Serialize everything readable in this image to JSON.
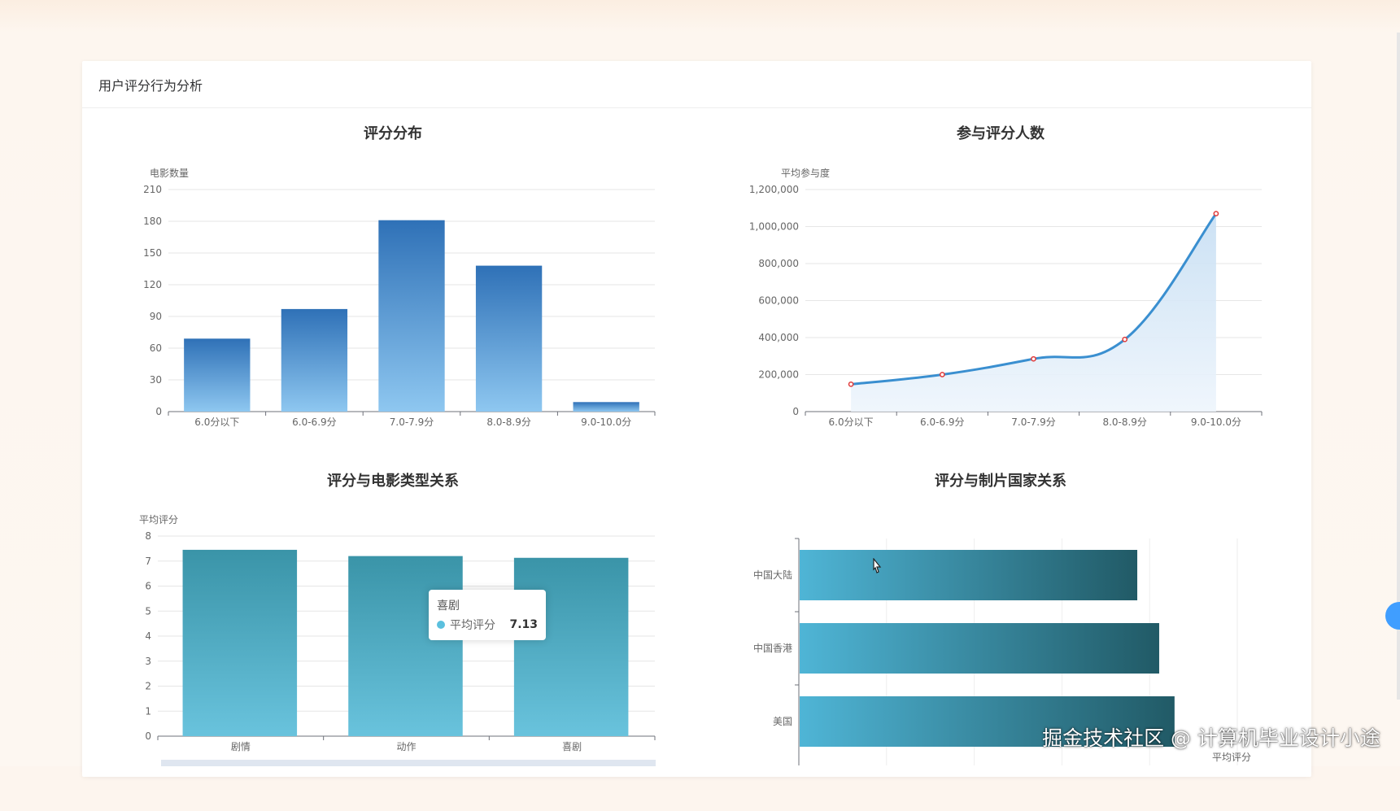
{
  "page": {
    "card_title": "用户评分行为分析",
    "watermark": "掘金技术社区 @ 计算机毕业设计小途"
  },
  "charts": {
    "rating_distribution": {
      "title": "评分分布",
      "ylabel": "电影数量"
    },
    "participation": {
      "title": "参与评分人数",
      "ylabel": "平均参与度"
    },
    "genre_relation": {
      "title": "评分与电影类型关系",
      "ylabel": "平均评分"
    },
    "country_relation": {
      "title": "评分与制片国家关系",
      "xlabel": "平均评分"
    }
  },
  "tooltip": {
    "title": "喜剧",
    "series": "平均评分",
    "value": "7.13",
    "color": "#5bc0de"
  },
  "colors": {
    "bar_top": "#2f71b7",
    "bar_bottom": "#8ec7f0",
    "line": "#3a8fd0",
    "area": "#cfe4f6",
    "point": "#e03a3a",
    "genre_top": "#3a94a8",
    "genre_bottom": "#69c3dd",
    "country_start": "#4fb5d6",
    "country_end": "#215a66"
  },
  "chart_data": [
    {
      "type": "bar",
      "title": "评分分布",
      "ylabel": "电影数量",
      "categories": [
        "6.0分以下",
        "6.0-6.9分",
        "7.0-7.9分",
        "8.0-8.9分",
        "9.0-10.0分"
      ],
      "values": [
        69,
        97,
        181,
        138,
        9
      ],
      "ylim": [
        0,
        210
      ],
      "yticks": [
        0,
        30,
        60,
        90,
        120,
        150,
        180,
        210
      ],
      "grid": true
    },
    {
      "type": "area",
      "title": "参与评分人数",
      "ylabel": "平均参与度",
      "categories": [
        "6.0分以下",
        "6.0-6.9分",
        "7.0-7.9分",
        "8.0-8.9分",
        "9.0-10.0分"
      ],
      "values": [
        148000,
        200000,
        285000,
        390000,
        1070000
      ],
      "ylim": [
        0,
        1200000
      ],
      "yticks": [
        "0",
        "200,000",
        "400,000",
        "600,000",
        "800,000",
        "1,000,000",
        "1,200,000"
      ],
      "grid": true
    },
    {
      "type": "bar",
      "title": "评分与电影类型关系",
      "ylabel": "平均评分",
      "categories": [
        "剧情",
        "动作",
        "喜剧"
      ],
      "values": [
        7.45,
        7.2,
        7.13
      ],
      "ylim": [
        0,
        8
      ],
      "yticks": [
        0,
        1,
        2,
        3,
        4,
        5,
        6,
        7,
        8
      ],
      "grid": true
    },
    {
      "type": "bar",
      "orientation": "horizontal",
      "title": "评分与制片国家关系",
      "xlabel": "平均评分",
      "categories": [
        "中国大陆",
        "中国香港",
        "美国"
      ],
      "values": [
        7.7,
        8.2,
        8.55
      ],
      "xlim": [
        0,
        10
      ],
      "grid": true
    }
  ]
}
